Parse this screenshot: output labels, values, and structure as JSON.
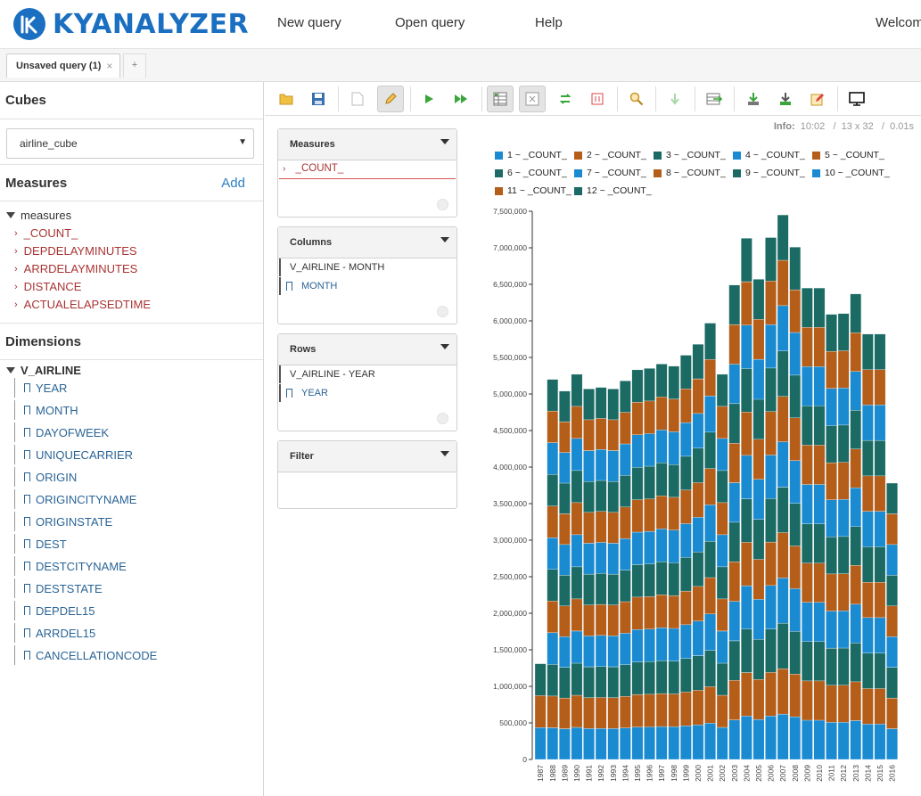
{
  "header": {
    "logo_text": "KYANALYZER",
    "nav": [
      {
        "label": "New query"
      },
      {
        "label": "Open query"
      },
      {
        "label": "Help"
      },
      {
        "label": "Welcom"
      }
    ]
  },
  "tabs": {
    "active_label": "Unsaved query (1)",
    "close_glyph": "×",
    "add_glyph": "+"
  },
  "sidebar": {
    "cubes_title": "Cubes",
    "cube_selected": "airline_cube",
    "measures_title": "Measures",
    "measures_add": "Add",
    "measures_root": "measures",
    "measures": [
      "_COUNT_",
      "DEPDELAYMINUTES",
      "ARRDELAYMINUTES",
      "DISTANCE",
      "ACTUALELAPSEDTIME"
    ],
    "dimensions_title": "Dimensions",
    "dimension_root": "V_AIRLINE",
    "dimension_levels": [
      "YEAR",
      "MONTH",
      "DAYOFWEEK",
      "UNIQUECARRIER",
      "ORIGIN",
      "ORIGINCITYNAME",
      "ORIGINSTATE",
      "DEST",
      "DESTCITYNAME",
      "DESTSTATE",
      "DEPDEL15",
      "ARRDEL15",
      "CANCELLATIONCODE"
    ]
  },
  "toolbar": {
    "icons": [
      "folder-open-icon",
      "save-icon",
      "new-document-icon",
      "edit-pencil-icon",
      "run-icon",
      "run-automatic-icon",
      "table-view-icon",
      "hide-empty-icon",
      "swap-axes-icon",
      "toggle-fields-icon",
      "zoom-icon",
      "drill-down-icon",
      "export-icon",
      "import-icon",
      "download-icon",
      "edit-note-icon",
      "presentation-icon"
    ]
  },
  "info": {
    "label": "Info:",
    "time": "10:02",
    "size": "13 x 32",
    "duration": "0.01s"
  },
  "panels": {
    "measures": {
      "title": "Measures",
      "items": [
        "_COUNT_"
      ]
    },
    "columns": {
      "title": "Columns",
      "hierarchy": "V_AIRLINE - MONTH",
      "level": "MONTH"
    },
    "rows": {
      "title": "Rows",
      "hierarchy": "V_AIRLINE - YEAR",
      "level": "YEAR"
    },
    "filter": {
      "title": "Filter"
    }
  },
  "colors": {
    "blue": "#1a8ad1",
    "orange": "#b55e1a",
    "teal": "#1b6b64",
    "accent": "#1b6fc1"
  },
  "chart_data": {
    "type": "bar",
    "stacked": true,
    "ylim": [
      0,
      7500000
    ],
    "yticks": [
      "0",
      "500,000",
      "1,000,000",
      "1,500,000",
      "2,000,000",
      "2,500,000",
      "3,000,000",
      "3,500,000",
      "4,000,000",
      "4,500,000",
      "5,000,000",
      "5,500,000",
      "6,000,000",
      "6,500,000",
      "7,000,000",
      "7,500,000"
    ],
    "ytick_values": [
      0,
      500000,
      1000000,
      1500000,
      2000000,
      2500000,
      3000000,
      3500000,
      4000000,
      4500000,
      5000000,
      5500000,
      6000000,
      6500000,
      7000000,
      7500000
    ],
    "categories": [
      "1987",
      "1988",
      "1989",
      "1990",
      "1991",
      "1992",
      "1993",
      "1994",
      "1995",
      "1996",
      "1997",
      "1998",
      "1999",
      "2000",
      "2001",
      "2002",
      "2003",
      "2004",
      "2005",
      "2006",
      "2007",
      "2008",
      "2009",
      "2010",
      "2011",
      "2012",
      "2013",
      "2014",
      "2015",
      "2016"
    ],
    "legend": [
      "1 ~ _COUNT_",
      "2 ~ _COUNT_",
      "3 ~ _COUNT_",
      "4 ~ _COUNT_",
      "5 ~ _COUNT_",
      "6 ~ _COUNT_",
      "7 ~ _COUNT_",
      "8 ~ _COUNT_",
      "9 ~ _COUNT_",
      "10 ~ _COUNT_",
      "11 ~ _COUNT_",
      "12 ~ _COUNT_"
    ],
    "legend_colors": [
      "#1a8ad1",
      "#b55e1a",
      "#1b6b64",
      "#1a8ad1",
      "#b55e1a",
      "#1b6b64",
      "#1a8ad1",
      "#b55e1a",
      "#1b6b64",
      "#1a8ad1",
      "#b55e1a",
      "#1b6b64"
    ],
    "totals": [
      1310000,
      5200000,
      5040000,
      5270000,
      5070000,
      5090000,
      5070000,
      5180000,
      5330000,
      5350000,
      5410000,
      5380000,
      5530000,
      5680000,
      5970000,
      5270000,
      6490000,
      7130000,
      6570000,
      7140000,
      7450000,
      7010000,
      6450000,
      6450000,
      6090000,
      6100000,
      6370000,
      5820000,
      5820000,
      3780000
    ],
    "start_month": [
      10,
      1,
      1,
      1,
      1,
      1,
      1,
      1,
      1,
      1,
      1,
      1,
      1,
      1,
      1,
      1,
      1,
      1,
      1,
      1,
      1,
      1,
      1,
      1,
      1,
      1,
      1,
      1,
      1,
      1
    ],
    "month_count": [
      3,
      12,
      12,
      12,
      12,
      12,
      12,
      12,
      12,
      12,
      12,
      12,
      12,
      12,
      12,
      12,
      12,
      12,
      12,
      12,
      12,
      12,
      12,
      12,
      12,
      12,
      12,
      12,
      12,
      9
    ]
  }
}
